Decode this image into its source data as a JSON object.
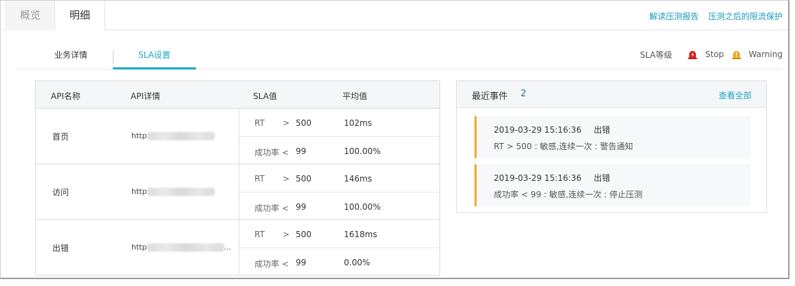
{
  "top_tabs": [
    {
      "label": "概览"
    },
    {
      "label": "明细"
    }
  ],
  "top_links": {
    "report": "解读压测报告",
    "protect": "压测之后的限流保护"
  },
  "sub_tabs": [
    {
      "label": "业务详情"
    },
    {
      "label": "SLA设置"
    }
  ],
  "sla_legend": {
    "label": "SLA等级",
    "stop": "Stop",
    "warning": "Warning",
    "stop_color": "#e02424",
    "warning_color": "#f5a623"
  },
  "table": {
    "headers": {
      "api_name": "API名称",
      "api_detail": "API详情",
      "sla": "SLA值",
      "avg": "平均值"
    },
    "rows": [
      {
        "name": "首页",
        "url": "http",
        "rt_label": "RT",
        "rt_op": ">",
        "rt_value": "500",
        "rt_avg": "102ms",
        "sr_label": "成功率 <",
        "sr_value": "99",
        "sr_avg": "100.00%"
      },
      {
        "name": "访问",
        "url": "http",
        "rt_label": "RT",
        "rt_op": ">",
        "rt_value": "500",
        "rt_avg": "146ms",
        "sr_label": "成功率 <",
        "sr_value": "99",
        "sr_avg": "100.00%"
      },
      {
        "name": "出错",
        "url": "http",
        "url_suffix": "...",
        "rt_label": "RT",
        "rt_op": ">",
        "rt_value": "500",
        "rt_avg": "1618ms",
        "sr_label": "成功率 <",
        "sr_value": "99",
        "sr_avg": "0.00%"
      }
    ]
  },
  "events": {
    "title": "最近事件",
    "count": "2",
    "view_all": "查看全部",
    "items": [
      {
        "time": "2019-03-29 15:16:36",
        "tag": "出错",
        "desc": "RT > 500 : 敏感,连续一次 : 警告通知"
      },
      {
        "time": "2019-03-29 15:16:36",
        "tag": "出错",
        "desc": "成功率 < 99 : 敏感,连续一次 : 停止压测"
      }
    ],
    "accent_color": "#f5a623"
  },
  "colors": {
    "accent": "#1aa7c4",
    "border": "#dcdcdc"
  }
}
